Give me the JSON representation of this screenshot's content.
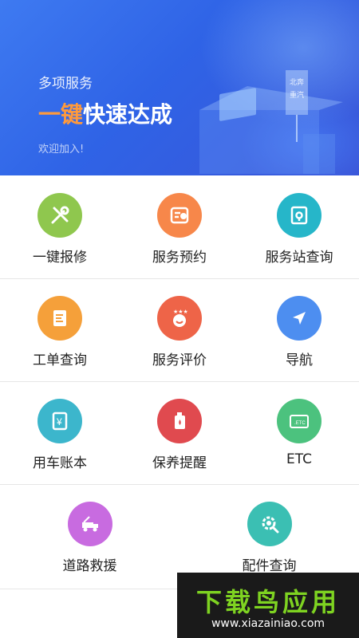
{
  "banner": {
    "subtitle": "多项服务",
    "title_highlight": "一键",
    "title_rest": "快速达成",
    "welcome": "欢迎加入!",
    "sign_text": "北奔重汽"
  },
  "services": [
    {
      "label": "一键报修",
      "icon": "wrench-screwdriver-icon",
      "color": "#8fc74e"
    },
    {
      "label": "服务预约",
      "icon": "calendar-clock-icon",
      "color": "#f7874a"
    },
    {
      "label": "服务站查询",
      "icon": "map-location-icon",
      "color": "#26b6c9"
    },
    {
      "label": "工单查询",
      "icon": "clipboard-icon",
      "color": "#f5a03a"
    },
    {
      "label": "服务评价",
      "icon": "smiley-stars-icon",
      "color": "#ee6448"
    },
    {
      "label": "导航",
      "icon": "navigation-arrow-icon",
      "color": "#4d8ef0"
    },
    {
      "label": "用车账本",
      "icon": "ledger-yen-icon",
      "color": "#3cb6cc"
    },
    {
      "label": "保养提醒",
      "icon": "oil-can-icon",
      "color": "#e04a4f"
    },
    {
      "label": "ETC",
      "icon": "etc-card-icon",
      "color": "#4cc27e"
    },
    {
      "label": "道路救援",
      "icon": "tow-truck-icon",
      "color": "#c86be0"
    },
    {
      "label": "配件查询",
      "icon": "gear-search-icon",
      "color": "#3bbfb3"
    }
  ],
  "watermark": {
    "brand": "下载鸟应用",
    "url": "www.xiazainiao.com"
  }
}
